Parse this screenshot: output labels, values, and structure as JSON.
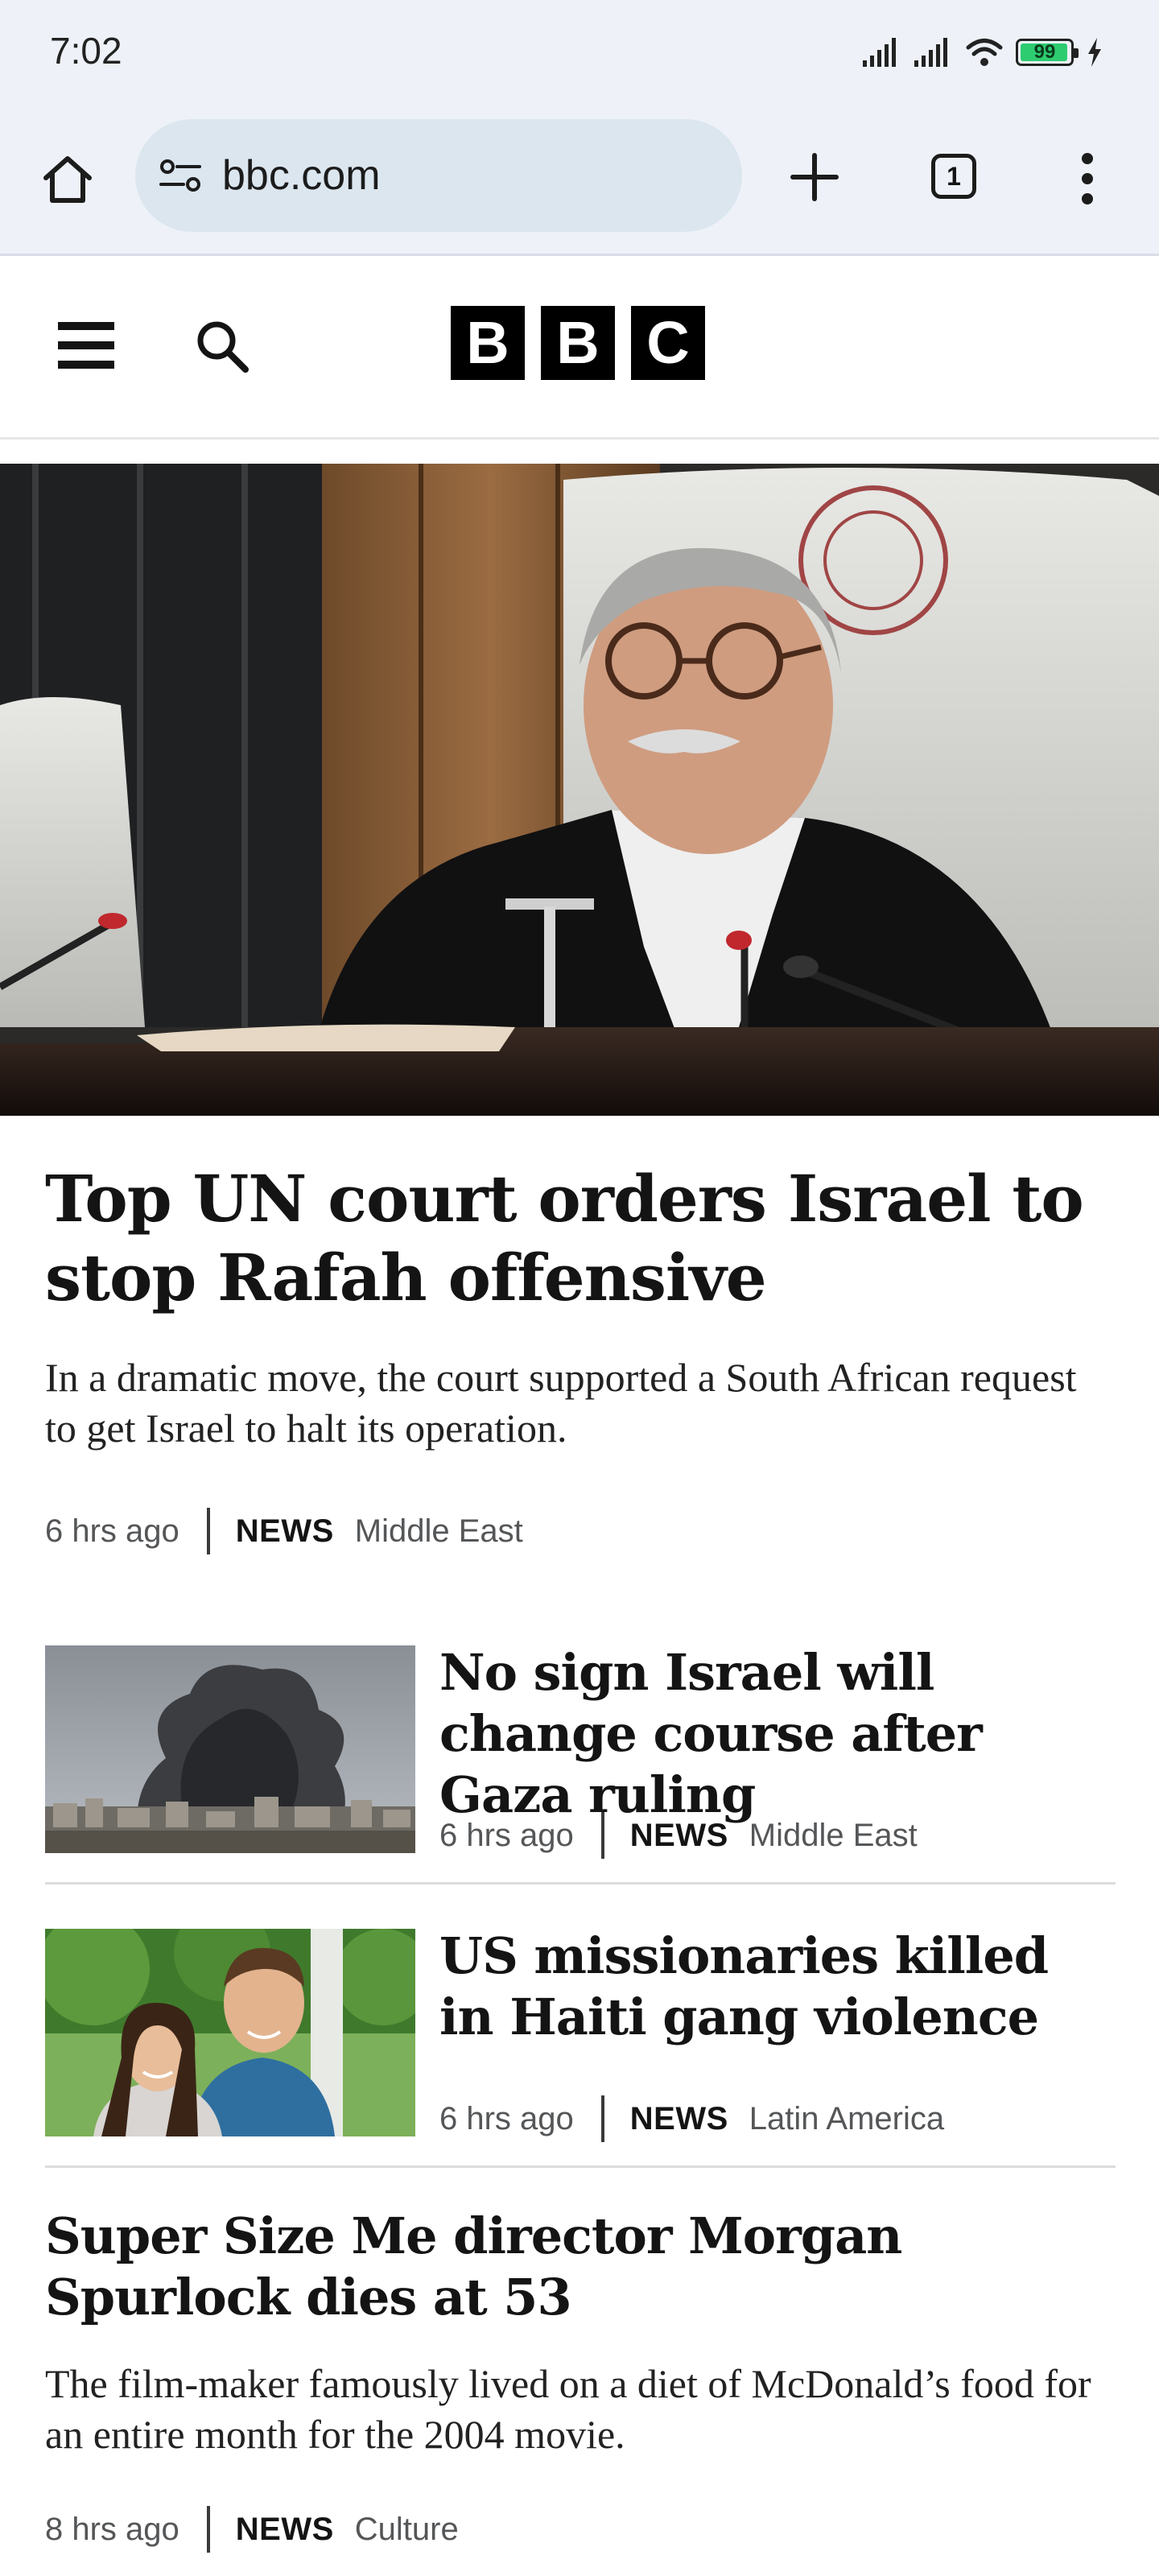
{
  "status_bar": {
    "time": "7:02",
    "battery_level": "99",
    "battery_color": "#2ecc71"
  },
  "browser": {
    "url": "bbc.com",
    "tab_count": "1",
    "icons": [
      "home-icon",
      "site-info-icon",
      "plus-icon",
      "tabs-icon",
      "more-menu-icon"
    ]
  },
  "site": {
    "logo_letters": [
      "B",
      "B",
      "C"
    ],
    "icons": [
      "hamburger-menu-icon",
      "search-icon"
    ]
  },
  "lead_story": {
    "title": "Top UN court orders Israel to stop Rafah offensive",
    "summary": "In a dramatic move, the court supported a South African request to get Israel to halt its operation.",
    "time": "6 hrs ago",
    "label": "NEWS",
    "section": "Middle East"
  },
  "stories": [
    {
      "title": "No sign Israel will change course after Gaza ruling",
      "time": "6 hrs ago",
      "label": "NEWS",
      "section": "Middle East"
    },
    {
      "title": "US missionaries killed in Haiti gang violence",
      "time": "6 hrs ago",
      "label": "NEWS",
      "section": "Latin America"
    },
    {
      "title": "Super Size Me director Morgan Spurlock dies at 53",
      "summary": "The film-maker famously lived on a diet of McDonald’s food for an entire month for the 2004 movie.",
      "time": "8 hrs ago",
      "label": "NEWS",
      "section": "Culture"
    }
  ]
}
